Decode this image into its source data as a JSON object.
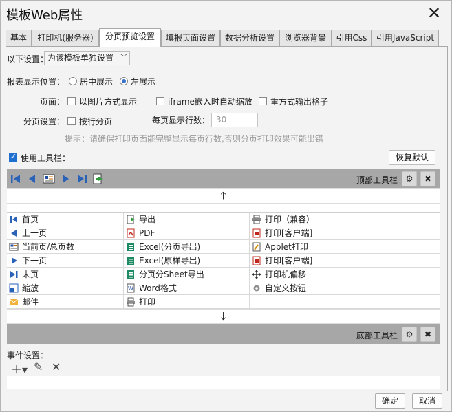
{
  "window": {
    "title": "模板Web属性",
    "close_icon": "close-icon"
  },
  "tabs": [
    {
      "label": "基本"
    },
    {
      "label": "打印机(服务器)"
    },
    {
      "label": "分页预览设置"
    },
    {
      "label": "填报页面设置"
    },
    {
      "label": "数据分析设置"
    },
    {
      "label": "浏览器背景"
    },
    {
      "label": "引用Css"
    },
    {
      "label": "引用JavaScript"
    }
  ],
  "active_tab": "分页预览设置",
  "settings": {
    "scope_label": "以下设置：",
    "scope_value": "为该模板单独设置",
    "position_label": "报表显示位置：",
    "position_options": [
      "居中展示",
      "左展示"
    ],
    "position_selected": "左展示",
    "page_label": "页面：",
    "page_options": [
      {
        "label": "以图片方式显示",
        "checked": false
      },
      {
        "label": "iframe嵌入时自动缩放",
        "checked": false
      },
      {
        "label": "重方式输出格子",
        "checked": false
      }
    ],
    "pagination_label": "分页设置：",
    "pagination_option": {
      "label": "按行分页",
      "checked": false
    },
    "rows_per_page_label": "每页显示行数：",
    "rows_per_page_value": "30",
    "hint": "提示：请确保打印页面能完整显示每页行数,否则分页打印效果可能出错",
    "use_toolbar": {
      "label": "使用工具栏：",
      "checked": true
    },
    "restore_default": "恢复默认"
  },
  "top_toolbar": {
    "label": "顶部工具栏"
  },
  "bottom_toolbar": {
    "label": "底部工具栏"
  },
  "available_buttons": [
    {
      "label": "首页",
      "icon": "first-page-icon"
    },
    {
      "label": "导出",
      "icon": "export-icon"
    },
    {
      "label": "打印（兼容）",
      "icon": "print-icon"
    },
    {
      "label": "上一页",
      "icon": "previous-page-icon"
    },
    {
      "label": "PDF",
      "icon": "pdf-icon"
    },
    {
      "label": "打印[客户端]",
      "icon": "pdf-print-icon"
    },
    {
      "label": "当前页/总页数",
      "icon": "page-counter-icon"
    },
    {
      "label": "Excel(分页导出)",
      "icon": "excel-icon"
    },
    {
      "label": "Applet打印",
      "icon": "applet-print-icon"
    },
    {
      "label": "下一页",
      "icon": "next-page-icon"
    },
    {
      "label": "Excel(原样导出)",
      "icon": "excel-icon"
    },
    {
      "label": "打印[客户端]",
      "icon": "pdf-print-icon"
    },
    {
      "label": "末页",
      "icon": "last-page-icon"
    },
    {
      "label": "分页分Sheet导出",
      "icon": "excel-icon"
    },
    {
      "label": "打印机偏移",
      "icon": "move-icon"
    },
    {
      "label": "缩放",
      "icon": "zoom-icon"
    },
    {
      "label": "Word格式",
      "icon": "word-icon"
    },
    {
      "label": "自定义按钮",
      "icon": "gear-icon"
    },
    {
      "label": "邮件",
      "icon": "mail-icon"
    },
    {
      "label": "打印",
      "icon": "print-icon"
    },
    {
      "label": "",
      "icon": ""
    }
  ],
  "events": {
    "label": "事件设置："
  },
  "footer": {
    "ok": "确定",
    "cancel": "取消"
  },
  "colors": {
    "accent": "#1f6fd1",
    "toolbar_bg": "#a7a7a7",
    "pdf_red": "#c0281e",
    "excel_green": "#1e8a63"
  }
}
